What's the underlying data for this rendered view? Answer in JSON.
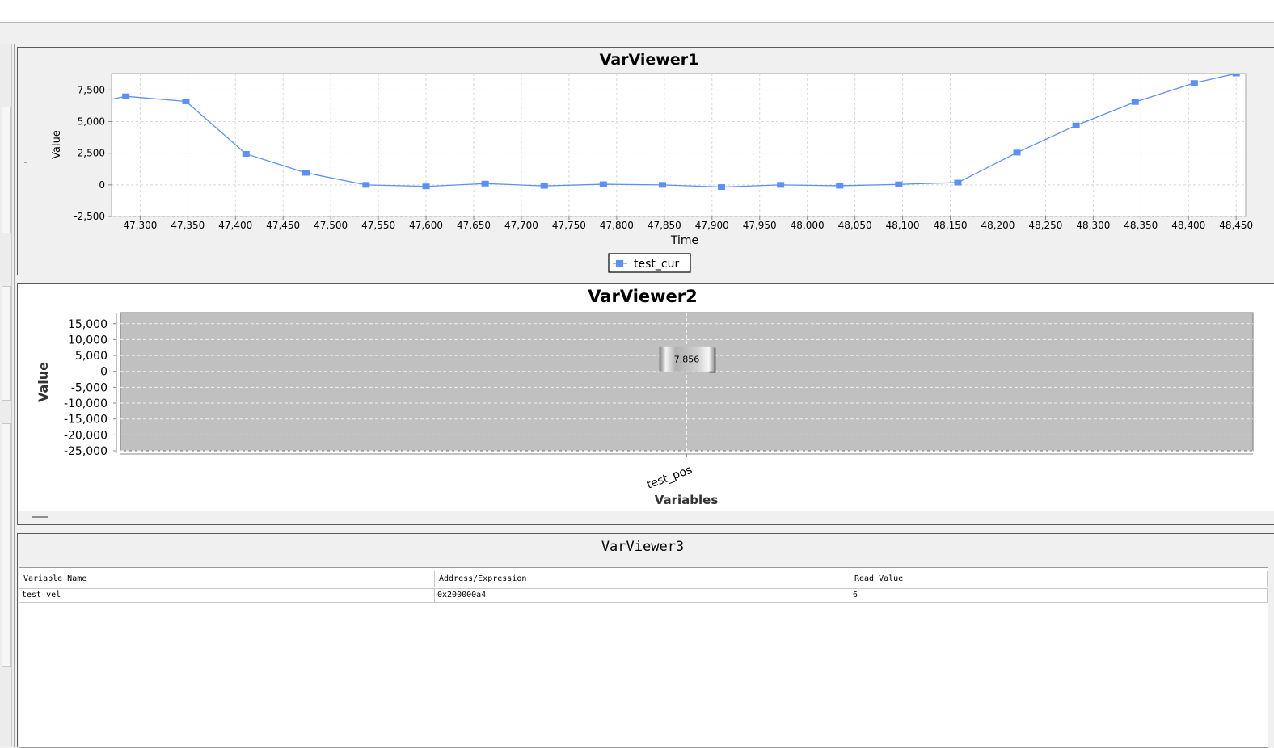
{
  "viewer1": {
    "title": "VarViewer1",
    "chart_data": {
      "type": "line",
      "title": "VarViewer1",
      "xlabel": "Time",
      "ylabel": "Value",
      "xlim": [
        47270,
        48460
      ],
      "ylim": [
        -2500,
        8800
      ],
      "x_ticks": [
        "47,300",
        "47,350",
        "47,400",
        "47,450",
        "47,500",
        "47,550",
        "47,600",
        "47,650",
        "47,700",
        "47,750",
        "47,800",
        "47,850",
        "47,900",
        "47,950",
        "48,000",
        "48,050",
        "48,100",
        "48,150",
        "48,200",
        "48,250",
        "48,300",
        "48,350",
        "48,400",
        "48,450"
      ],
      "y_ticks": [
        "7,500",
        "5,000",
        "2,500",
        "0",
        "-2,500"
      ],
      "grid": true,
      "legend": "bottom-center",
      "series": [
        {
          "name": "test_cur",
          "color": "#5b8ff9",
          "x": [
            47253,
            47285,
            47348,
            47411,
            47474,
            47537,
            47600,
            47662,
            47724,
            47786,
            47848,
            47910,
            47972,
            48034,
            48096,
            48158,
            48220,
            48282,
            48344,
            48406,
            48450
          ],
          "y": [
            6500,
            7000,
            6600,
            2450,
            950,
            0,
            -120,
            100,
            -80,
            50,
            0,
            -170,
            0,
            -70,
            40,
            180,
            2550,
            4700,
            6550,
            8050,
            8800
          ]
        }
      ]
    }
  },
  "viewer2": {
    "title": "VarViewer2",
    "chart_data": {
      "type": "bar",
      "title": "VarViewer2",
      "xlabel": "Variables",
      "ylabel": "Value",
      "categories": [
        "test_pos"
      ],
      "values": [
        7856
      ],
      "data_labels": [
        "7,856"
      ],
      "ylim": [
        -25000,
        18500
      ],
      "y_ticks": [
        "15,000",
        "10,000",
        "5,000",
        "0",
        "-5,000",
        "-10,000",
        "-15,000",
        "-20,000",
        "-25,000"
      ],
      "grid": true,
      "background": "#c0c0c0"
    }
  },
  "viewer3": {
    "title": "VarViewer3",
    "columns": [
      "Variable Name",
      "Address/Expression",
      "Read Value"
    ],
    "rows": [
      [
        "test_vel",
        "0x200000a4",
        "6"
      ]
    ]
  }
}
